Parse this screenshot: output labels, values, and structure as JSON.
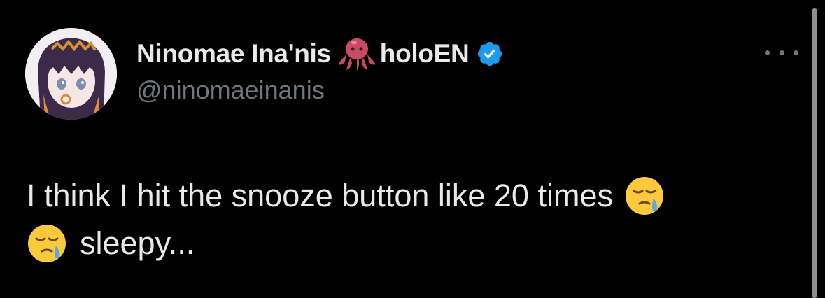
{
  "tweet": {
    "author": {
      "display_name": "Ninomae Ina'nis",
      "affiliation": "holoEN",
      "name_emoji": "octopus-icon",
      "verified_icon": "verified-badge-icon",
      "handle": "@ninomaeinanis",
      "avatar": "profile-avatar"
    },
    "text_line1": "I think I hit the snooze button like 20 times",
    "text_line2": "sleepy...",
    "text_emoji": "sleepy-face-emoji",
    "menu_icon": "more-options-icon"
  },
  "colors": {
    "background": "#000000",
    "text": "#e7e9ea",
    "secondary_text": "#71767b",
    "verified": "#1d9bf0"
  }
}
